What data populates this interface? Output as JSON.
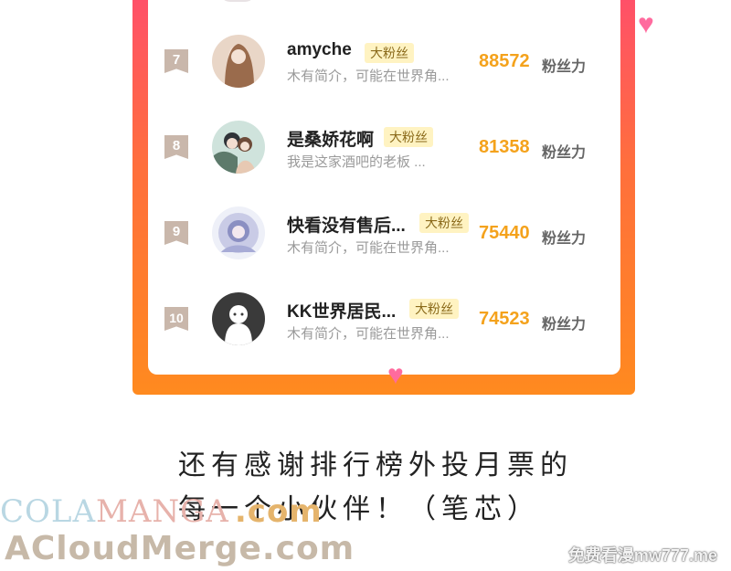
{
  "fans": [
    {
      "rank": "7",
      "name": "amyche",
      "badge": "大粉丝",
      "bio": "木有简介，可能在世界角...",
      "count": "88572",
      "unit": "粉丝力"
    },
    {
      "rank": "8",
      "name": "是桑娇花啊",
      "badge": "大粉丝",
      "bio": "我是这家酒吧的老板  ...",
      "count": "81358",
      "unit": "粉丝力"
    },
    {
      "rank": "9",
      "name": "快看没有售后...",
      "badge": "大粉丝",
      "bio": "木有简介，可能在世界角...",
      "count": "75440",
      "unit": "粉丝力"
    },
    {
      "rank": "10",
      "name": "KK世界居民...",
      "badge": "大粉丝",
      "bio": "木有简介，可能在世界角...",
      "count": "74523",
      "unit": "粉丝力"
    }
  ],
  "caption": {
    "line1": "还有感谢排行榜外投月票的",
    "line2": "每一个小伙伴！（笔芯）"
  },
  "watermarks": {
    "cola": "COLA",
    "manga": "MANGA",
    "com1": ".com",
    "acloud": "ACloudMerge.com",
    "mw": "免费看漫mw777.me"
  },
  "colors": {
    "frame_top": "#ff4d6d",
    "frame_bottom": "#ff8a1f",
    "count": "#f4a21c",
    "badge_bg": "#fff3c2",
    "heart": "#ff6b9e"
  }
}
